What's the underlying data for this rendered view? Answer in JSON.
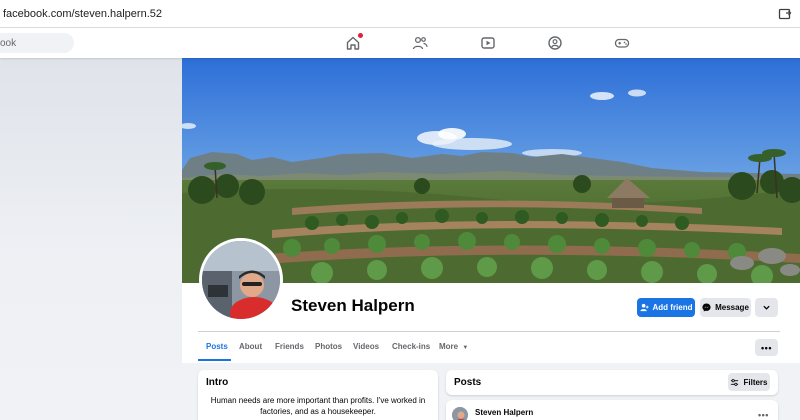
{
  "browser": {
    "url": "facebook.com/steven.halpern.52",
    "extension_icon": "extension-icon"
  },
  "header": {
    "search_placeholder": "ook",
    "nav": [
      {
        "name": "home-icon",
        "has_notification": true
      },
      {
        "name": "friends-icon"
      },
      {
        "name": "video-icon"
      },
      {
        "name": "groups-icon"
      },
      {
        "name": "gaming-icon"
      }
    ]
  },
  "profile": {
    "name": "Steven Halpern",
    "add_friend_label": "Add friend",
    "message_label": "Message"
  },
  "tabs": [
    {
      "label": "Posts",
      "active": true
    },
    {
      "label": "About"
    },
    {
      "label": "Friends"
    },
    {
      "label": "Photos"
    },
    {
      "label": "Videos"
    },
    {
      "label": "Check-ins"
    },
    {
      "label": "More"
    }
  ],
  "intro": {
    "title": "Intro",
    "bio": "Human needs are more important than profits. I've worked in factories, and as a housekeeper."
  },
  "posts": {
    "title": "Posts",
    "filters_label": "Filters",
    "first_post_author": "Steven Halpern"
  },
  "colors": {
    "accent": "#1b74e4",
    "page_bg": "#f0f2f5",
    "notification": "#e41e3f"
  }
}
